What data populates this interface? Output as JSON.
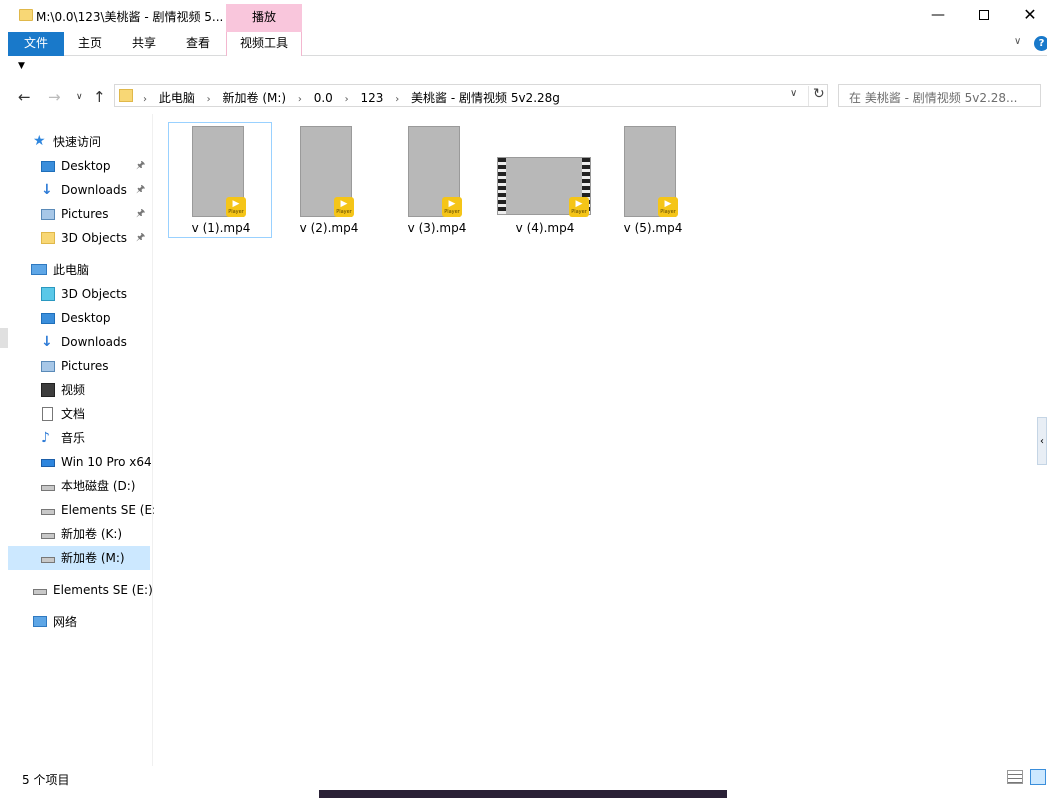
{
  "window": {
    "title": "M:\\0.0\\123\\美桃酱 - 剧情视频 5...",
    "context_tab_group": "播放"
  },
  "ribbon": {
    "tabs": [
      "文件",
      "主页",
      "共享",
      "查看",
      "视频工具"
    ]
  },
  "address": {
    "crumbs": [
      "此电脑",
      "新加卷 (M:)",
      "0.0",
      "123",
      "美桃酱 - 剧情视频 5v2.28g"
    ]
  },
  "search": {
    "placeholder": "在 美桃酱 - 剧情视频 5v2.28..."
  },
  "navpane": {
    "quick_access": {
      "label": "快速访问",
      "items": [
        {
          "label": "Desktop",
          "icon": "desktop-icon",
          "pinned": true
        },
        {
          "label": "Downloads",
          "icon": "download-icon",
          "pinned": true
        },
        {
          "label": "Pictures",
          "icon": "pictures-icon",
          "pinned": true
        },
        {
          "label": "3D Objects",
          "icon": "folder-icon",
          "pinned": true
        }
      ]
    },
    "this_pc": {
      "label": "此电脑",
      "items": [
        {
          "label": "3D Objects",
          "icon": "3d-objects-icon"
        },
        {
          "label": "Desktop",
          "icon": "desktop-icon"
        },
        {
          "label": "Downloads",
          "icon": "download-icon"
        },
        {
          "label": "Pictures",
          "icon": "pictures-icon"
        },
        {
          "label": "视频",
          "icon": "video-icon"
        },
        {
          "label": "文档",
          "icon": "document-icon"
        },
        {
          "label": "音乐",
          "icon": "music-icon"
        },
        {
          "label": "Win 10 Pro x64",
          "icon": "windows-drive-icon"
        },
        {
          "label": "本地磁盘 (D:)",
          "icon": "drive-icon"
        },
        {
          "label": "Elements SE (E:",
          "icon": "drive-icon"
        },
        {
          "label": "新加卷 (K:)",
          "icon": "drive-icon"
        },
        {
          "label": "新加卷 (M:)",
          "icon": "drive-icon",
          "selected": true
        }
      ]
    },
    "external": {
      "label": "Elements SE (E:)",
      "icon": "drive-icon"
    },
    "network": {
      "label": "网络",
      "icon": "network-icon"
    }
  },
  "files": [
    {
      "name": "v (1).mp4",
      "selected": true,
      "orientation": "portrait"
    },
    {
      "name": "v (2).mp4",
      "selected": false,
      "orientation": "portrait"
    },
    {
      "name": "v (3).mp4",
      "selected": false,
      "orientation": "portrait"
    },
    {
      "name": "v (4).mp4",
      "selected": false,
      "orientation": "landscape"
    },
    {
      "name": "v (5).mp4",
      "selected": false,
      "orientation": "portrait"
    }
  ],
  "badge": {
    "sub": "Player"
  },
  "status": {
    "item_count": "5 个项目"
  },
  "colors": {
    "accent": "#1979ca",
    "context_tab": "#f9c6dc",
    "selection": "#cce8ff",
    "badge": "#f5c518"
  }
}
